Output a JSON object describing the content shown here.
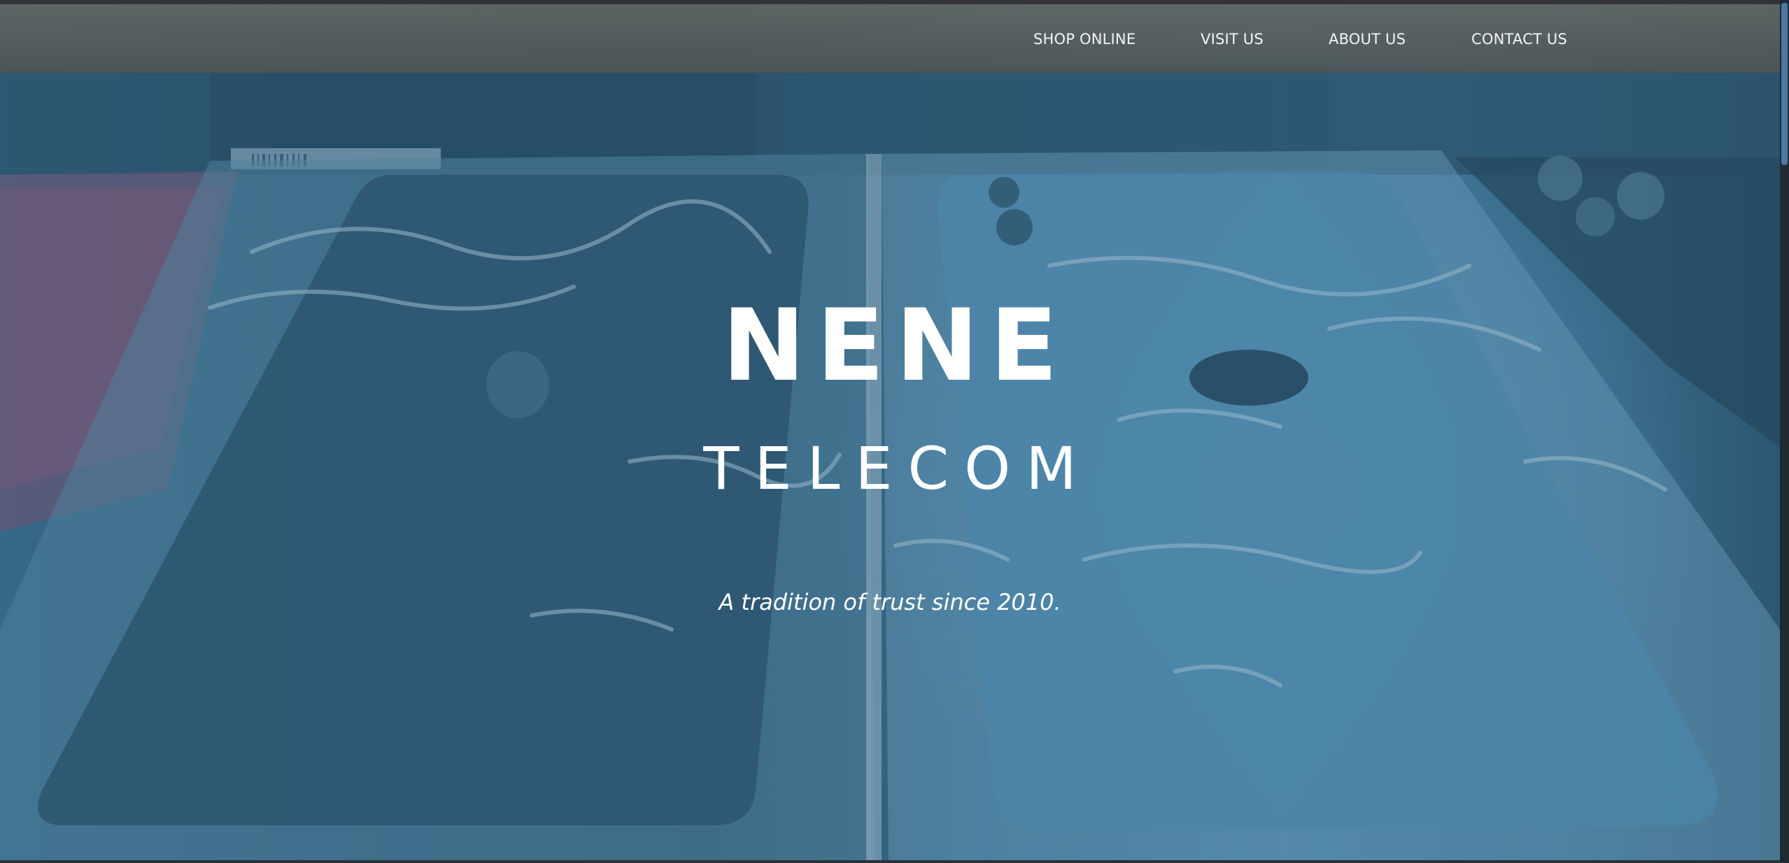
{
  "nav": {
    "items": [
      {
        "label": "SHOP ONLINE"
      },
      {
        "label": "VISIT US"
      },
      {
        "label": "ABOUT US"
      },
      {
        "label": "CONTACT US"
      }
    ]
  },
  "hero": {
    "title": "NENE",
    "subtitle": "TELECOM",
    "tagline": "A tradition of trust since 2010.",
    "background_image": "boxed smartphones under plastic wrap",
    "overlay_color": "#2f6585"
  },
  "colors": {
    "nav_background": "#5a5e5a",
    "nav_text": "#f2f4f4",
    "hero_text": "#ffffff",
    "scrollbar_thumb": "#4a7aa3"
  }
}
